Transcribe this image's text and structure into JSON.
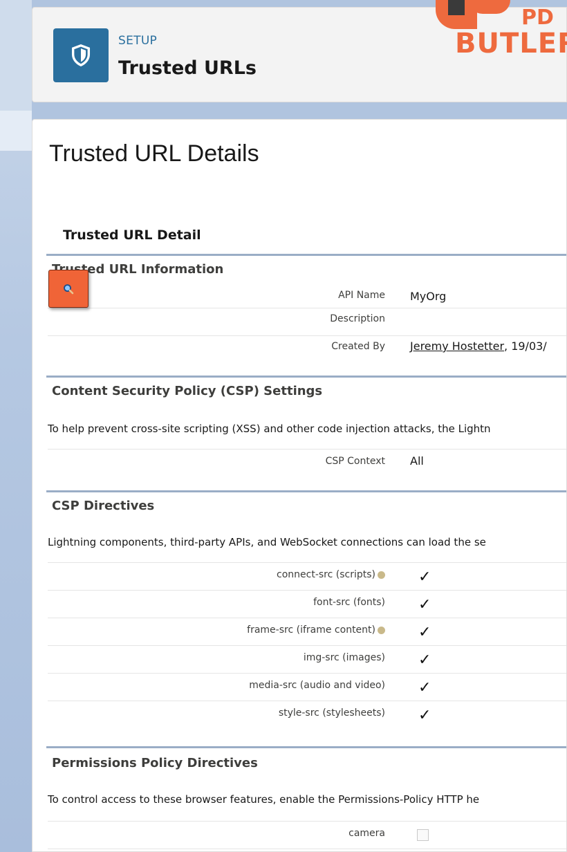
{
  "header": {
    "eyebrow": "SETUP",
    "title": "Trusted URLs",
    "icon": "shield-icon"
  },
  "logo": {
    "line1": "PD",
    "line2": "BUTLER"
  },
  "page": {
    "heading": "Trusted URL Details",
    "detail_title": "Trusted URL Detail"
  },
  "sections": {
    "info": {
      "title": "Trusted URL Information",
      "rows": [
        {
          "label": "API Name",
          "value": "MyOrg"
        },
        {
          "label": "Description",
          "value": ""
        },
        {
          "label": "Created By",
          "user": "Jeremy Hostetter",
          "suffix": ", 19/03/"
        }
      ]
    },
    "csp": {
      "title": "Content Security Policy (CSP) Settings",
      "text": "To help prevent cross-site scripting (XSS) and other code injection attacks, the Lightn",
      "rows": [
        {
          "label": "CSP Context",
          "value": "All"
        }
      ]
    },
    "directives": {
      "title": "CSP Directives",
      "text": "Lightning components, third-party APIs, and WebSocket connections can load the se",
      "rows": [
        {
          "label": "connect-src (scripts)",
          "help": true,
          "checked": true
        },
        {
          "label": "font-src (fonts)",
          "help": false,
          "checked": true
        },
        {
          "label": "frame-src (iframe content)",
          "help": true,
          "checked": true
        },
        {
          "label": "img-src (images)",
          "help": false,
          "checked": true
        },
        {
          "label": "media-src (audio and video)",
          "help": false,
          "checked": true
        },
        {
          "label": "style-src (stylesheets)",
          "help": false,
          "checked": true
        }
      ],
      "check_glyph": "✓"
    },
    "permissions": {
      "title": "Permissions Policy Directives",
      "text": "To control access to these browser features, enable the Permissions-Policy HTTP he",
      "rows": [
        {
          "label": "camera",
          "checked": false
        }
      ]
    }
  },
  "floating_button": {
    "icon": "search-icon",
    "color": "#f06437"
  },
  "colors": {
    "brand": "#2a6f9e",
    "logo": "#ee6a3e",
    "section_rule": "#9aadc6"
  }
}
